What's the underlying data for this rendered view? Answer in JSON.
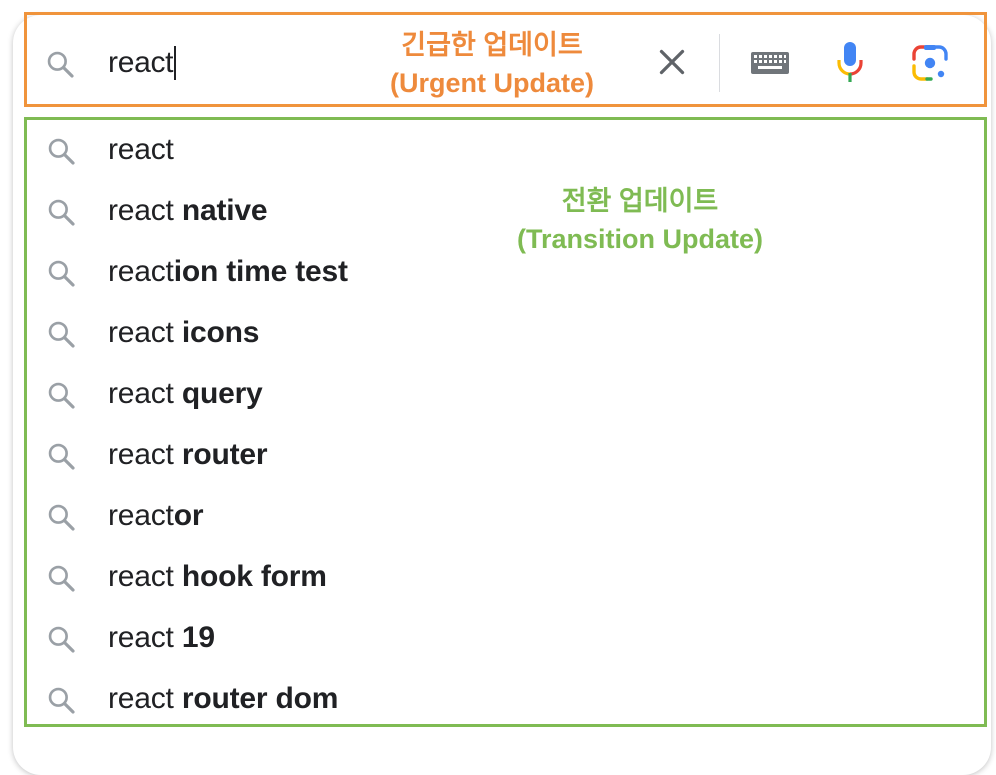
{
  "search": {
    "query": "react"
  },
  "annotations": {
    "urgent_ko": "긴급한 업데이트",
    "urgent_en": "(Urgent Update)",
    "transition_ko": "전환 업데이트",
    "transition_en": "(Transition Update)"
  },
  "suggestions": [
    {
      "prefix": "react",
      "suffix": ""
    },
    {
      "prefix": "react",
      "suffix": " native"
    },
    {
      "prefix": "react",
      "suffix": "ion time test"
    },
    {
      "prefix": "react",
      "suffix": " icons"
    },
    {
      "prefix": "react",
      "suffix": " query"
    },
    {
      "prefix": "react",
      "suffix": " router"
    },
    {
      "prefix": "react",
      "suffix": "or"
    },
    {
      "prefix": "react",
      "suffix": " hook form"
    },
    {
      "prefix": "react",
      "suffix": " 19"
    },
    {
      "prefix": "react",
      "suffix": " router dom"
    }
  ],
  "icons": {
    "search": "search-icon",
    "clear": "close-icon",
    "keyboard": "keyboard-icon",
    "voice": "microphone-icon",
    "lens": "camera-lens-icon"
  },
  "colors": {
    "urgent_highlight": "#f0943c",
    "transition_highlight": "#7fbb53",
    "text": "#202124",
    "icon_gray": "#9aa0a6"
  }
}
